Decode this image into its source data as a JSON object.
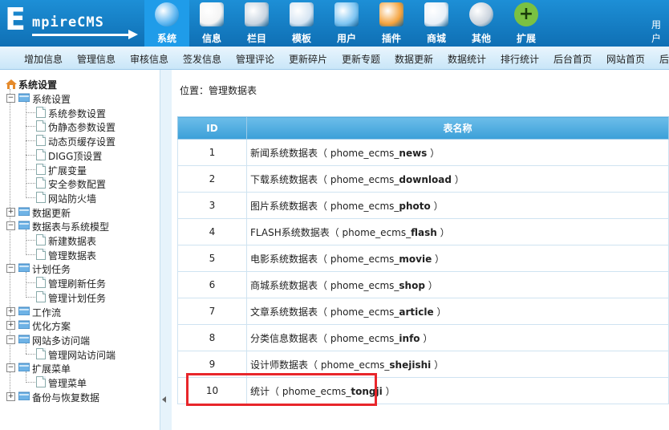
{
  "header": {
    "logo_text": "EmpireCMS",
    "user_label": "用户",
    "menu": [
      {
        "label": "系统",
        "icon": "globe-icon",
        "color": "#5ab4f0"
      },
      {
        "label": "信息",
        "icon": "document-edit-icon",
        "color": "#f4f4f4"
      },
      {
        "label": "栏目",
        "icon": "folder-icon",
        "color": "#c8d4e0"
      },
      {
        "label": "模板",
        "icon": "window-template-icon",
        "color": "#d5e4f2"
      },
      {
        "label": "用户",
        "icon": "user-icon",
        "color": "#7cc4f2"
      },
      {
        "label": "插件",
        "icon": "tools-icon",
        "color": "#f4a23c"
      },
      {
        "label": "商城",
        "icon": "card-icon",
        "color": "#e8f0f8"
      },
      {
        "label": "其他",
        "icon": "gear-icon",
        "color": "#c9d2dc"
      },
      {
        "label": "扩展",
        "icon": "plus-circle-icon",
        "color": "#7ac142"
      }
    ]
  },
  "subnav": [
    "增加信息",
    "管理信息",
    "审核信息",
    "签发信息",
    "管理评论",
    "更新碎片",
    "更新专题",
    "数据更新",
    "数据统计",
    "排行统计",
    "后台首页",
    "网站首页",
    "后"
  ],
  "sidebar": {
    "root": "系统设置",
    "groups": [
      {
        "label": "系统设置",
        "open": true,
        "children": [
          "系统参数设置",
          "伪静态参数设置",
          "动态页缓存设置",
          "DIGG顶设置",
          "扩展变量",
          "安全参数配置",
          "网站防火墙"
        ]
      },
      {
        "label": "数据更新",
        "open": false,
        "children": []
      },
      {
        "label": "数据表与系统模型",
        "open": true,
        "children": [
          "新建数据表",
          "管理数据表"
        ]
      },
      {
        "label": "计划任务",
        "open": true,
        "children": [
          "管理刷新任务",
          "管理计划任务"
        ]
      },
      {
        "label": "工作流",
        "open": false,
        "children": []
      },
      {
        "label": "优化方案",
        "open": false,
        "children": []
      },
      {
        "label": "网站多访问端",
        "open": true,
        "children": [
          "管理网站访问端"
        ]
      },
      {
        "label": "扩展菜单",
        "open": true,
        "children": [
          "管理菜单"
        ]
      },
      {
        "label": "备份与恢复数据",
        "open": false,
        "children": []
      }
    ]
  },
  "main": {
    "position_label": "位置：",
    "position_value": "管理数据表",
    "table": {
      "headers": [
        "ID",
        "表名称"
      ],
      "rows": [
        {
          "id": "1",
          "name": "新闻系统数据表",
          "table": "phome_ecms_news"
        },
        {
          "id": "2",
          "name": "下载系统数据表",
          "table": "phome_ecms_download"
        },
        {
          "id": "3",
          "name": "图片系统数据表",
          "table": "phome_ecms_photo"
        },
        {
          "id": "4",
          "name": "FLASH系统数据表",
          "table": "phome_ecms_flash"
        },
        {
          "id": "5",
          "name": "电影系统数据表",
          "table": "phome_ecms_movie"
        },
        {
          "id": "6",
          "name": "商城系统数据表",
          "table": "phome_ecms_shop"
        },
        {
          "id": "7",
          "name": "文章系统数据表",
          "table": "phome_ecms_article"
        },
        {
          "id": "8",
          "name": "分类信息数据表",
          "table": "phome_ecms_info"
        },
        {
          "id": "9",
          "name": "设计师数据表",
          "table": "phome_ecms_shejishi"
        },
        {
          "id": "10",
          "name": "统计",
          "table": "phome_ecms_tongji"
        }
      ]
    },
    "highlight_color": "#e8262b"
  }
}
